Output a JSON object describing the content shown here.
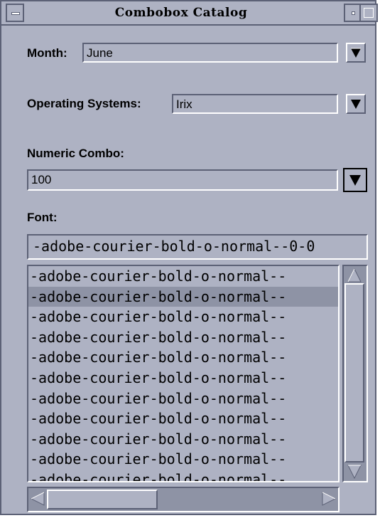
{
  "window": {
    "title": "Combobox Catalog"
  },
  "month": {
    "label": "Month:",
    "value": "June"
  },
  "os": {
    "label": "Operating Systems:",
    "value": "Irix"
  },
  "numeric": {
    "label": "Numeric Combo:",
    "value": "100"
  },
  "font": {
    "label": "Font:",
    "value": "-adobe-courier-bold-o-normal--0-0",
    "items": [
      "-adobe-courier-bold-o-normal--",
      "-adobe-courier-bold-o-normal--",
      "-adobe-courier-bold-o-normal--",
      "-adobe-courier-bold-o-normal--",
      "-adobe-courier-bold-o-normal--",
      "-adobe-courier-bold-o-normal--",
      "-adobe-courier-bold-o-normal--",
      "-adobe-courier-bold-o-normal--",
      "-adobe-courier-bold-o-normal--",
      "-adobe-courier-bold-o-normal--",
      "-adobe-courier-bold-o-normal--"
    ],
    "selected_index": 1
  },
  "icons": {
    "dropdown": "triangle-down-icon",
    "scroll_up": "triangle-up-icon",
    "scroll_down": "triangle-down-icon",
    "scroll_left": "triangle-left-icon",
    "scroll_right": "triangle-right-icon"
  },
  "colors": {
    "background": "#aeb2c3",
    "shadow": "#5c6176",
    "trough": "#8e93a5",
    "highlight": "#ffffff"
  }
}
